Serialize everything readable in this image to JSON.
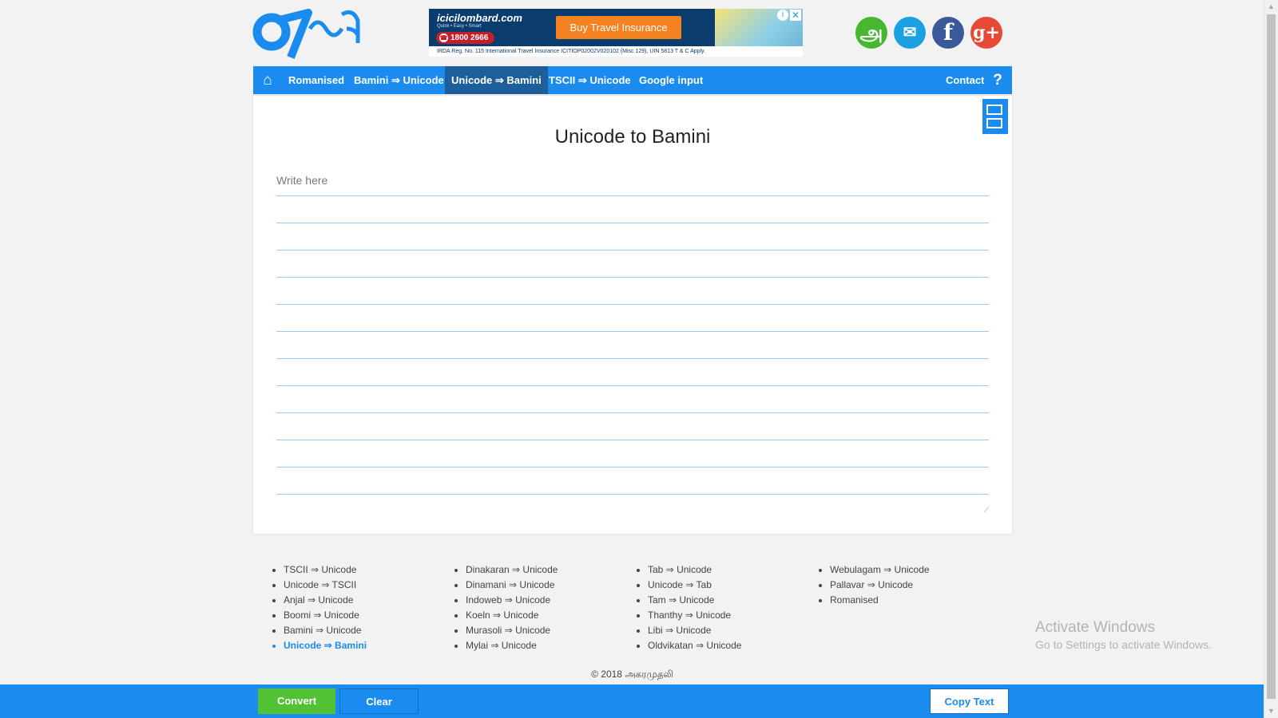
{
  "header": {
    "ad": {
      "brand": "icicilombard.com",
      "tagline": "Quick • Easy • Smart",
      "phone": "1800 2666",
      "cta": "Buy Travel Insurance",
      "legal": "IRDA Reg. No. 115 International Travel Insurance ICITIOP02002V020102 (Misc 129), UIN 5813 T & C Apply."
    },
    "social": {
      "tamil_glyph": "அ",
      "facebook_glyph": "f",
      "google_glyph": "g+"
    }
  },
  "nav": {
    "items": [
      {
        "label": "Romanised"
      },
      {
        "label": "Bamini ⇒ Unicode"
      },
      {
        "label": "Unicode ⇒ Bamini"
      },
      {
        "label": "TSCII ⇒ Unicode"
      },
      {
        "label": "Google input"
      }
    ],
    "active_index": 2,
    "contact": "Contact",
    "help": "?"
  },
  "main": {
    "title": "Unicode to Bamini",
    "editor_placeholder": "Write here"
  },
  "links": {
    "col1": [
      "TSCII ⇒ Unicode",
      "Unicode ⇒ TSCII",
      "Anjal ⇒ Unicode",
      "Boomi ⇒ Unicode",
      "Bamini ⇒ Unicode",
      "Unicode ⇒ Bamini"
    ],
    "col2": [
      "Dinakaran ⇒ Unicode",
      "Dinamani ⇒ Unicode",
      "Indoweb ⇒ Unicode",
      "Koeln ⇒ Unicode",
      "Murasoli ⇒ Unicode",
      "Mylai ⇒ Unicode"
    ],
    "col3": [
      "Tab ⇒ Unicode",
      "Unicode ⇒ Tab",
      "Tam ⇒ Unicode",
      "Thanthy ⇒ Unicode",
      "Libi ⇒ Unicode",
      "Oldvikatan ⇒ Unicode"
    ],
    "col4": [
      "Webulagam ⇒ Unicode",
      "Pallavar ⇒ Unicode",
      "Romanised"
    ]
  },
  "footer": {
    "copyright": "© 2018 அகரமுதலி"
  },
  "watermark": {
    "line1": "Activate Windows",
    "line2": "Go to Settings to activate Windows."
  },
  "bottombar": {
    "convert": "Convert",
    "clear": "Clear",
    "copy": "Copy Text"
  },
  "colors": {
    "primary": "#1a8cf0",
    "active_nav": "#1e5f9b",
    "convert": "#52c234"
  },
  "icons": {
    "home": "home-icon",
    "help": "help-icon",
    "layout": "split-layout-icon"
  }
}
